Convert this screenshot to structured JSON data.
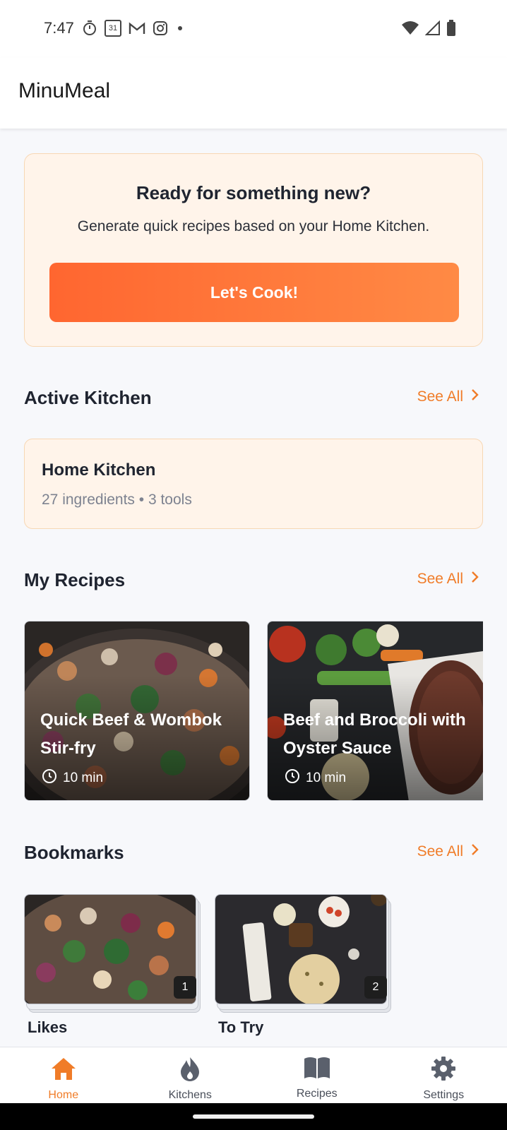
{
  "status_bar": {
    "time": "7:47",
    "calendar_day": "31"
  },
  "app_bar": {
    "title": "MinuMeal"
  },
  "hero": {
    "title": "Ready for something new?",
    "subtitle": "Generate quick recipes based on your Home Kitchen.",
    "button_label": "Let's Cook!"
  },
  "active_kitchen": {
    "section_title": "Active Kitchen",
    "see_all": "See All",
    "name": "Home Kitchen",
    "meta": "27 ingredients • 3 tools"
  },
  "my_recipes": {
    "section_title": "My Recipes",
    "see_all": "See All",
    "items": [
      {
        "name": "Quick Beef & Wombok Stir-fry",
        "time": "10 min"
      },
      {
        "name": "Beef and Broccoli with Oyster Sauce",
        "time": "10 min"
      }
    ]
  },
  "bookmarks": {
    "section_title": "Bookmarks",
    "see_all": "See All",
    "items": [
      {
        "label": "Likes",
        "count": "1"
      },
      {
        "label": "To Try",
        "count": "2"
      }
    ]
  },
  "bottom_nav": {
    "items": [
      {
        "label": "Home",
        "icon": "home-icon",
        "active": true
      },
      {
        "label": "Kitchens",
        "icon": "flame-icon",
        "active": false
      },
      {
        "label": "Recipes",
        "icon": "book-icon",
        "active": false
      },
      {
        "label": "Settings",
        "icon": "gear-icon",
        "active": false
      }
    ]
  },
  "colors": {
    "accent": "#f07c28",
    "button_start": "#ff6630",
    "button_end": "#ff8a45",
    "card_bg": "#fff4ea"
  }
}
